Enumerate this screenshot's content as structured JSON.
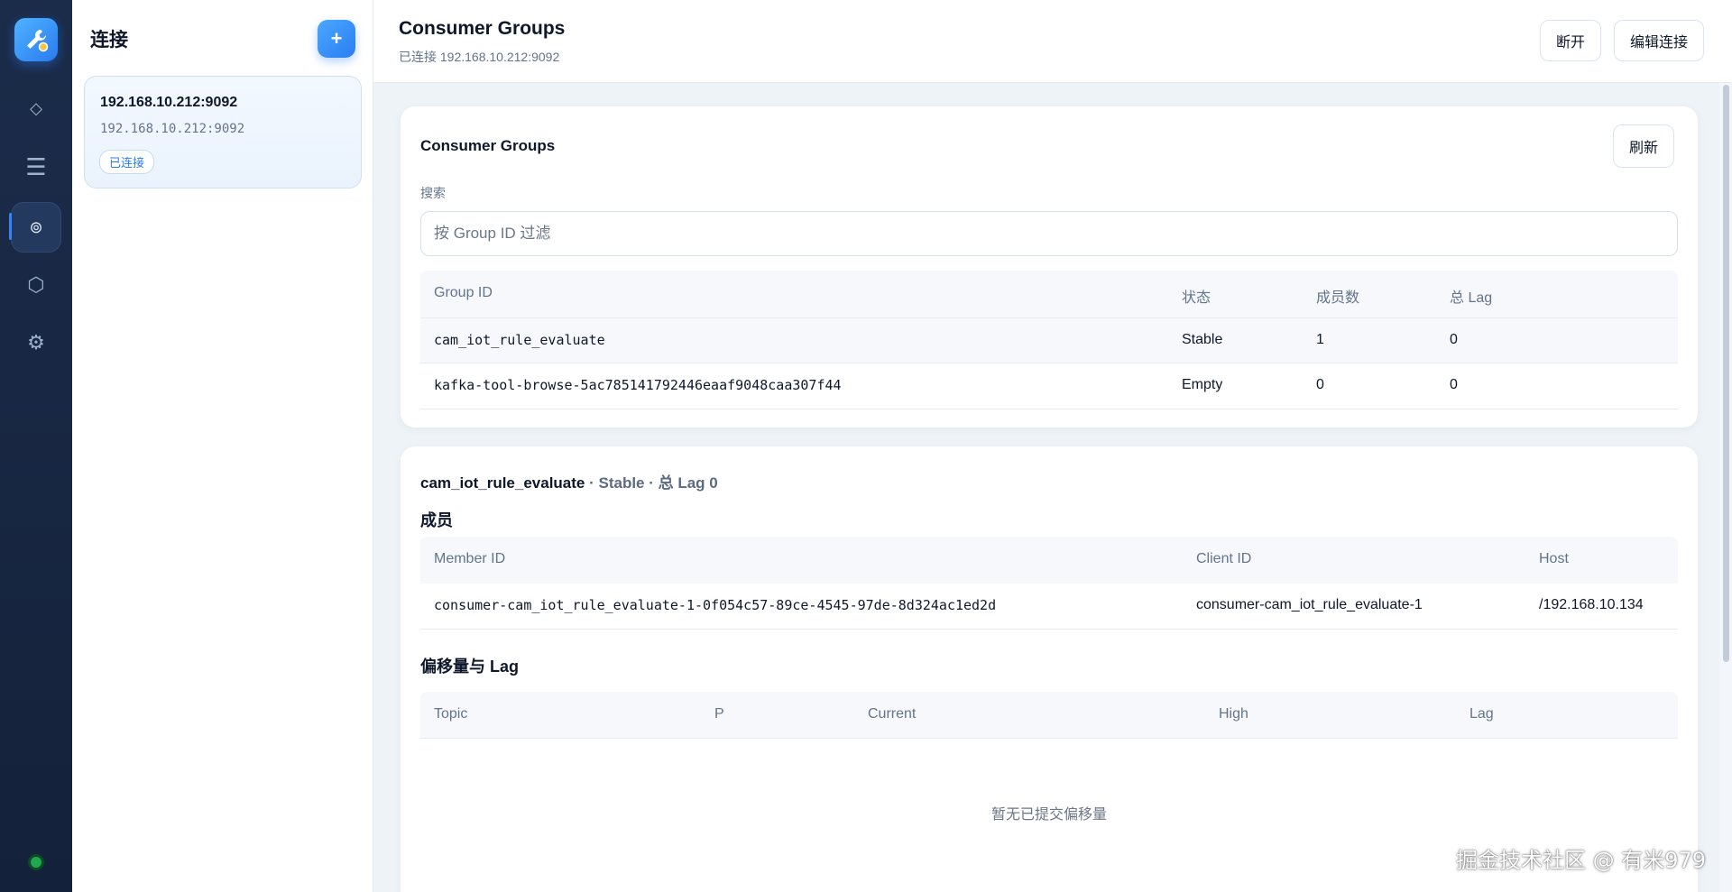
{
  "colors": {
    "accent": "#2b7df2",
    "rail_bg": "#1b2c4a",
    "status_ok": "#1fa84f"
  },
  "rail": {
    "items": [
      {
        "name": "diamond-icon",
        "glyph": "◇"
      },
      {
        "name": "menu-icon",
        "glyph": "☰"
      },
      {
        "name": "consumer-groups-icon",
        "glyph": "⊚"
      },
      {
        "name": "hexagon-icon",
        "glyph": "⬡"
      },
      {
        "name": "settings-icon",
        "glyph": "⚙"
      }
    ]
  },
  "sidebar": {
    "title": "连接",
    "add_label": "+",
    "connections": [
      {
        "name": "192.168.10.212:9092",
        "address": "192.168.10.212:9092",
        "status": "已连接"
      }
    ]
  },
  "header": {
    "title": "Consumer Groups",
    "subtitle": "已连接 192.168.10.212:9092",
    "disconnect_label": "断开",
    "edit_label": "编辑连接"
  },
  "groups_panel": {
    "title": "Consumer Groups",
    "refresh_label": "刷新",
    "search_label": "搜索",
    "search_placeholder": "按 Group ID 过滤",
    "search_value": "",
    "columns": [
      "Group ID",
      "状态",
      "成员数",
      "总 Lag"
    ],
    "rows": [
      {
        "group_id": "cam_iot_rule_evaluate",
        "state": "Stable",
        "members": "1",
        "lag": "0"
      },
      {
        "group_id": "kafka-tool-browse-5ac785141792446eaaf9048caa307f44",
        "state": "Empty",
        "members": "0",
        "lag": "0"
      }
    ]
  },
  "detail_panel": {
    "group_name": "cam_iot_rule_evaluate",
    "meta": " · Stable · 总 Lag 0",
    "members_title": "成员",
    "member_columns": [
      "Member ID",
      "Client ID",
      "Host"
    ],
    "members": [
      {
        "member_id": "consumer-cam_iot_rule_evaluate-1-0f054c57-89ce-4545-97de-8d324ac1ed2d",
        "client_id": "consumer-cam_iot_rule_evaluate-1",
        "host": "/192.168.10.134"
      }
    ],
    "offsets_title": "偏移量与 Lag",
    "offset_columns": [
      "Topic",
      "P",
      "Current",
      "High",
      "Lag"
    ],
    "offsets_empty": "暂无已提交偏移量"
  },
  "watermark": "掘金技术社区 @ 有米979"
}
